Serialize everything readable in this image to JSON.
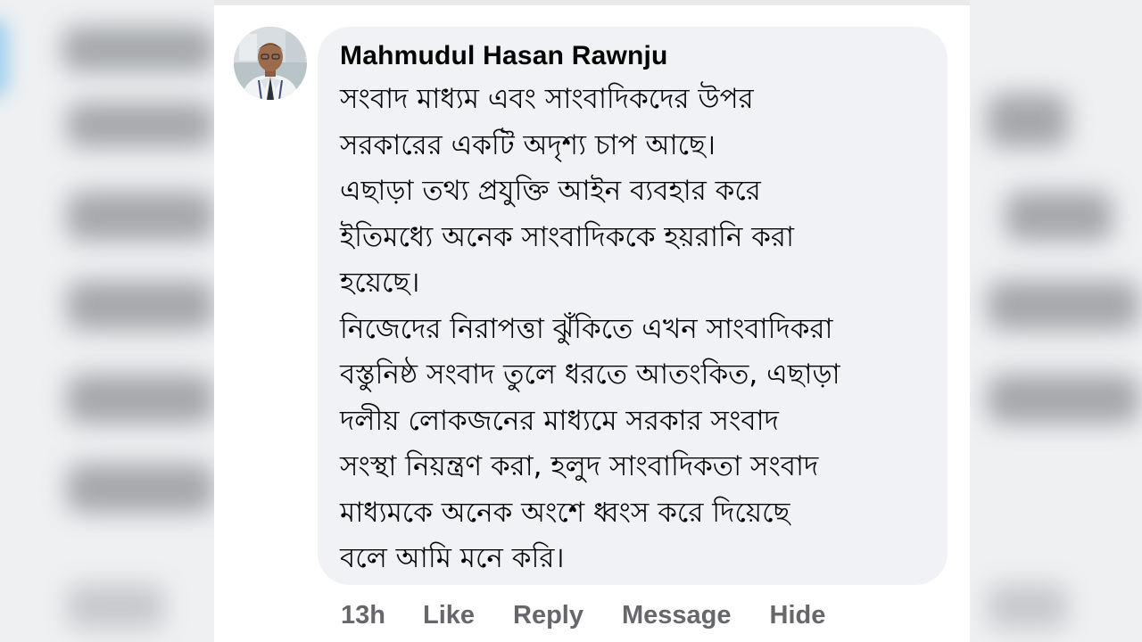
{
  "comment": {
    "author": "Mahmudul Hasan Rawnju",
    "lines": [
      "সংবাদ মাধ্যম এবং সাংবাদিকদের উপর",
      "সরকারের একটি অদৃশ্য চাপ আছে।",
      "এছাড়া তথ্য প্রযুক্তি আইন ব্যবহার করে",
      "ইতিমধ্যে অনেক সাংবাদিককে হয়রানি করা",
      "হয়েছে।",
      "নিজেদের নিরাপত্তা ঝুঁকিতে এখন সাংবাদিকরা",
      "বস্তুনিষ্ঠ সংবাদ তুলে ধরতে আতংকিত, এছাড়া",
      "দলীয় লোকজনের মাধ্যমে সরকার সংবাদ",
      "সংস্থা নিয়ন্ত্রণ করা, হলুদ সাংবাদিকতা সংবাদ",
      "মাধ্যমকে অনেক অংশে ধ্বংস করে দিয়েছে",
      "বলে আমি মনে করি।"
    ]
  },
  "actions": {
    "time": "13h",
    "like": "Like",
    "reply": "Reply",
    "message": "Message",
    "hide": "Hide"
  },
  "colors": {
    "bubble": "#f0f2f5",
    "text": "#050505",
    "action": "#65676b"
  }
}
